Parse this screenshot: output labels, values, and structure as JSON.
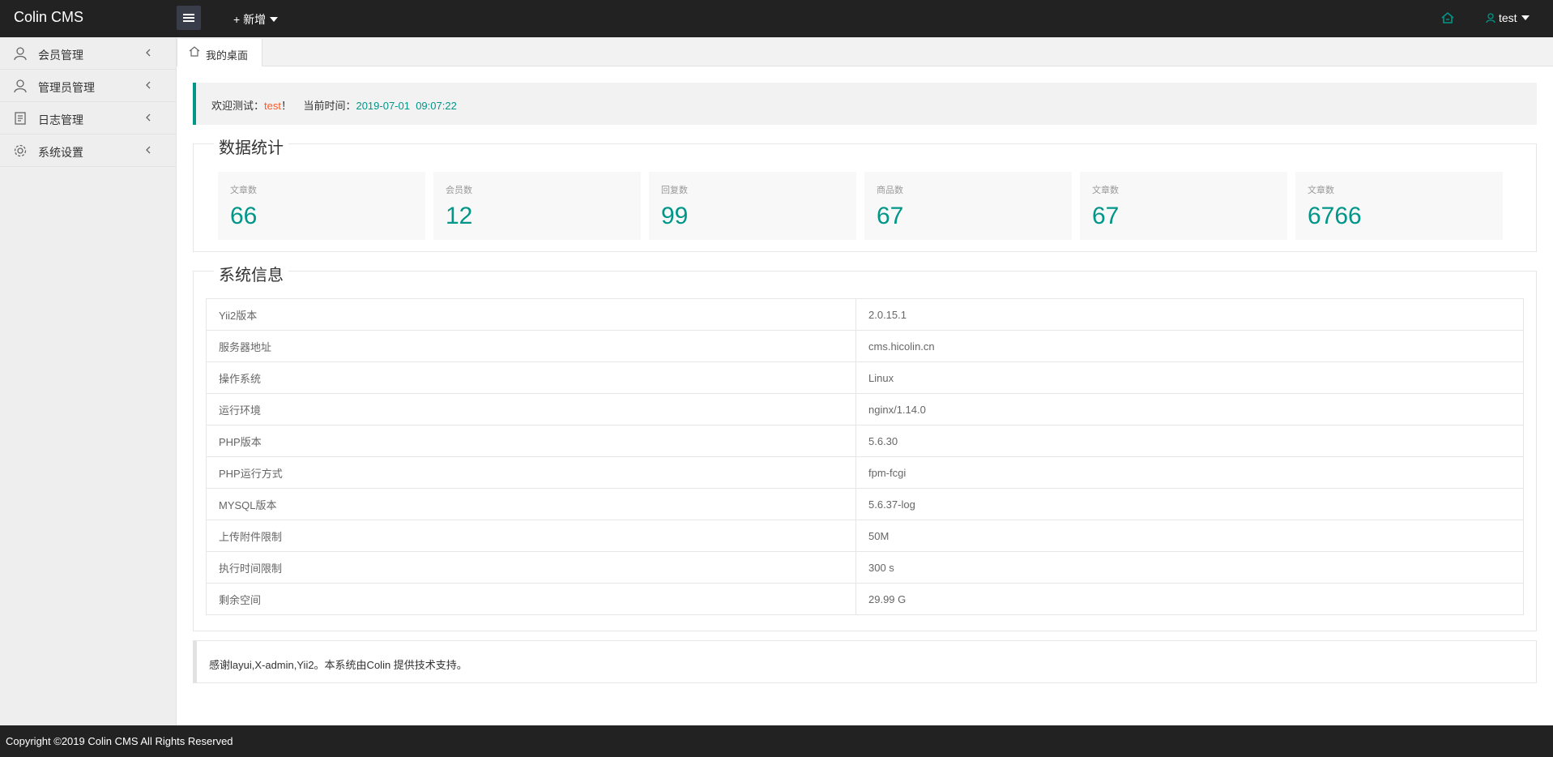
{
  "header": {
    "logo": "Colin CMS",
    "add_label": "+ 新增",
    "username": "test"
  },
  "sidebar": {
    "items": [
      {
        "label": "会员管理",
        "icon": "user-icon"
      },
      {
        "label": "管理员管理",
        "icon": "admin-icon"
      },
      {
        "label": "日志管理",
        "icon": "log-icon"
      },
      {
        "label": "系统设置",
        "icon": "gear-icon"
      }
    ]
  },
  "tab": {
    "label": "我的桌面",
    "icon": "home-icon"
  },
  "welcome": {
    "prefix": "欢迎测试：",
    "user": "test",
    "suffix": "！",
    "time_label": "当前时间：",
    "time_value": "2019-07-01  09:07:22"
  },
  "stats": {
    "title": "数据统计",
    "items": [
      {
        "label": "文章数",
        "value": "66"
      },
      {
        "label": "会员数",
        "value": "12"
      },
      {
        "label": "回复数",
        "value": "99"
      },
      {
        "label": "商品数",
        "value": "67"
      },
      {
        "label": "文章数",
        "value": "67"
      },
      {
        "label": "文章数",
        "value": "6766"
      }
    ]
  },
  "sysinfo": {
    "title": "系统信息",
    "rows": [
      [
        "Yii2版本",
        "2.0.15.1"
      ],
      [
        "服务器地址",
        "cms.hicolin.cn"
      ],
      [
        "操作系统",
        "Linux"
      ],
      [
        "运行环境",
        "nginx/1.14.0"
      ],
      [
        "PHP版本",
        "5.6.30"
      ],
      [
        "PHP运行方式",
        "fpm-fcgi"
      ],
      [
        "MYSQL版本",
        "5.6.37-log"
      ],
      [
        "上传附件限制",
        "50M"
      ],
      [
        "执行时间限制",
        "300 s"
      ],
      [
        "剩余空间",
        "29.99 G"
      ]
    ]
  },
  "thanks": "感谢layui,X-admin,Yii2。本系统由Colin 提供技术支持。",
  "footer": "Copyright ©2019 Colin CMS All Rights Reserved",
  "colors": {
    "accent": "#009688",
    "highlight": "#FF5722",
    "header_bg": "#222222"
  }
}
